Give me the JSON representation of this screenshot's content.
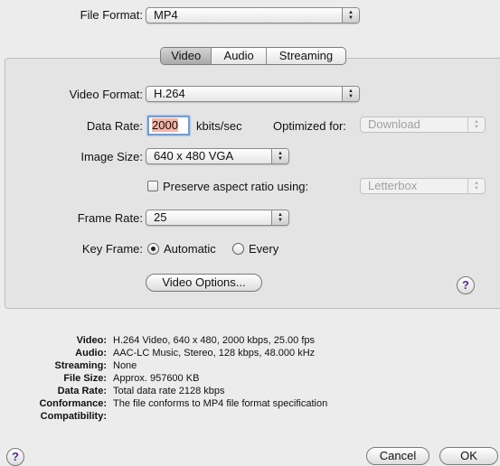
{
  "file_format": {
    "label": "File Format:",
    "value": "MP4"
  },
  "tabs": [
    {
      "label": "Video",
      "selected": true
    },
    {
      "label": "Audio",
      "selected": false
    },
    {
      "label": "Streaming",
      "selected": false
    }
  ],
  "video": {
    "video_format": {
      "label": "Video Format:",
      "value": "H.264"
    },
    "data_rate": {
      "label": "Data Rate:",
      "value": "2000",
      "unit": "kbits/sec"
    },
    "optimized_for": {
      "label": "Optimized for:",
      "value": "Download"
    },
    "image_size": {
      "label": "Image Size:",
      "value": "640 x 480 VGA"
    },
    "preserve_aspect": {
      "label": "Preserve aspect ratio using:",
      "value": "Letterbox",
      "checked": false
    },
    "frame_rate": {
      "label": "Frame Rate:",
      "value": "25"
    },
    "key_frame": {
      "label": "Key Frame:",
      "options": [
        "Automatic",
        "Every"
      ],
      "selected": "Automatic"
    },
    "options_button": "Video Options..."
  },
  "help_label": "?",
  "summary": [
    {
      "key": "Video:",
      "value": "H.264 Video, 640 x 480, 2000 kbps, 25.00 fps"
    },
    {
      "key": "Audio:",
      "value": "AAC-LC Music, Stereo, 128 kbps, 48.000 kHz"
    },
    {
      "key": "Streaming:",
      "value": "None"
    },
    {
      "key": "File Size:",
      "value": "Approx. 957600 KB"
    },
    {
      "key": "Data Rate:",
      "value": "Total data rate 2128 kbps"
    },
    {
      "key": "Conformance:",
      "value": "The file conforms to MP4 file format specification"
    },
    {
      "key": "Compatibility:",
      "value": ""
    }
  ],
  "buttons": {
    "cancel": "Cancel",
    "ok": "OK"
  }
}
